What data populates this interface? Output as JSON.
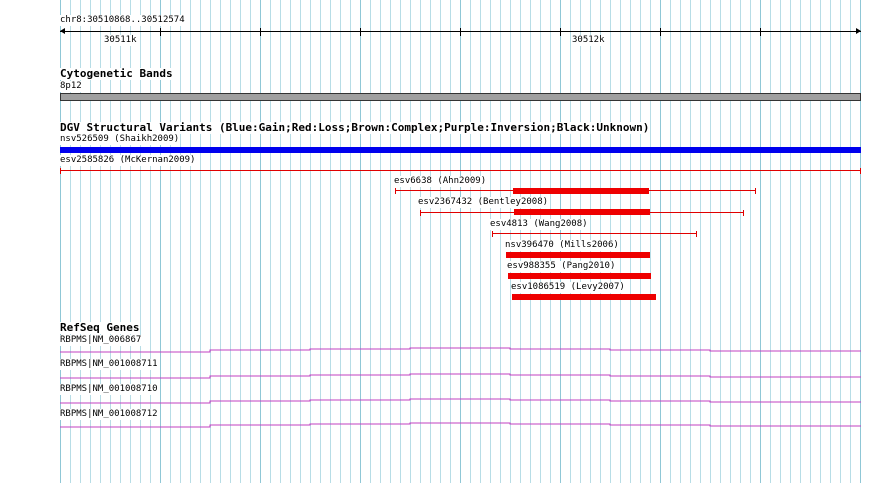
{
  "ruler": {
    "location": "chr8:30510868..30512574",
    "tick_labels": [
      "30511k",
      "30512k"
    ]
  },
  "cytobands": {
    "title": "Cytogenetic Bands",
    "band_label": "8p12"
  },
  "dgv": {
    "title": "DGV Structural Variants (Blue:Gain;Red:Loss;Brown:Complex;Purple:Inversion;Black:Unknown)",
    "variants": [
      {
        "label": "nsv526509 (Shaikh2009)",
        "color": "#0000ee"
      },
      {
        "label": "esv2585826 (McKernan2009)",
        "color": "#e00000"
      },
      {
        "label": "esv6638 (Ahn2009)",
        "color": "#e00000"
      },
      {
        "label": "esv2367432 (Bentley2008)",
        "color": "#e00000"
      },
      {
        "label": "esv4813 (Wang2008)",
        "color": "#e00000"
      },
      {
        "label": "nsv396470 (Mills2006)",
        "color": "#e00000"
      },
      {
        "label": "esv988355 (Pang2010)",
        "color": "#e00000"
      },
      {
        "label": "esv1086519 (Levy2007)",
        "color": "#e00000"
      }
    ]
  },
  "refseq": {
    "title": "RefSeq Genes",
    "genes": [
      {
        "label": "RBPMS|NM_006867"
      },
      {
        "label": "RBPMS|NM_001008711"
      },
      {
        "label": "RBPMS|NM_001008710"
      },
      {
        "label": "RBPMS|NM_001008712"
      }
    ],
    "gene_color": "#c040c0"
  }
}
